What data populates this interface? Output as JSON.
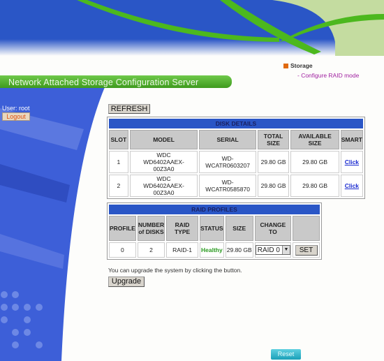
{
  "header": {
    "title": "Network Attached Storage Configuration Server"
  },
  "nav": {
    "section": "Storage",
    "item": "- Configure RAID mode"
  },
  "sidebar": {
    "user_label": "User: root",
    "logout_label": "Logout"
  },
  "toolbar": {
    "refresh_label": "REFRESH"
  },
  "disk_details": {
    "title": "DISK DETAILS",
    "columns": [
      "SLOT",
      "MODEL",
      "SERIAL",
      "TOTAL SIZE",
      "AVAILABLE SIZE",
      "SMART"
    ],
    "rows": [
      {
        "slot": "1",
        "model": "WDC WD6402AAEX-00Z3A0",
        "serial": "WD-WCATR0603207",
        "total": "29.80 GB",
        "available": "29.80 GB",
        "smart": "Click"
      },
      {
        "slot": "2",
        "model": "WDC WD6402AAEX-00Z3A0",
        "serial": "WD-WCATR0585870",
        "total": "29.80 GB",
        "available": "29.80 GB",
        "smart": "Click"
      }
    ]
  },
  "raid_profiles": {
    "title": "RAID PROFILES",
    "columns": [
      "PROFILE",
      "NUMBER of DISKS",
      "RAID TYPE",
      "STATUS",
      "SIZE",
      "CHANGE TO",
      ""
    ],
    "rows": [
      {
        "profile": "0",
        "disks": "2",
        "type": "RAID-1",
        "status": "Healthy",
        "size": "29.80 GB",
        "change_to": "RAID 0",
        "set": "SET"
      }
    ]
  },
  "upgrade": {
    "message": "You can upgrade the system by clicking the button.",
    "button": "Upgrade"
  },
  "footer": {
    "reset_label": "Reset"
  },
  "colors": {
    "banner_blue": "#2a56c6",
    "accent_green": "#4cb81e",
    "status_healthy": "#2a9a20"
  }
}
